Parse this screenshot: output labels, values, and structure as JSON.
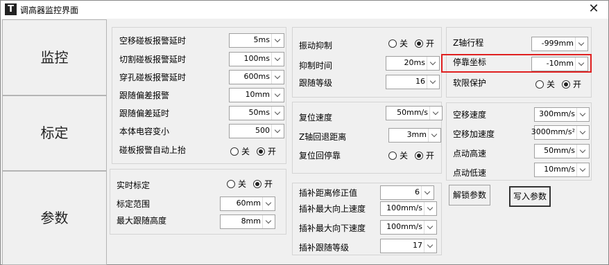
{
  "window": {
    "title": "调高器监控界面",
    "icon_letter": "T",
    "close_glyph": "✕"
  },
  "nav": {
    "monitor": "监控",
    "calibration": "标定",
    "params": "参数"
  },
  "alarms": {
    "items": [
      {
        "label": "空移碰板报警延时",
        "value": "5ms"
      },
      {
        "label": "切割碰板报警延时",
        "value": "100ms"
      },
      {
        "label": "穿孔碰板报警延时",
        "value": "600ms"
      },
      {
        "label": "跟随偏差报警",
        "value": "10mm"
      },
      {
        "label": "跟随偏差延时",
        "value": "50ms"
      },
      {
        "label": "本体电容变小",
        "value": "500"
      }
    ],
    "auto_lift": {
      "label": "碰板报警自动上抬",
      "off": "关",
      "on": "开",
      "selected": "on"
    }
  },
  "realtime_cal": {
    "label": "实时标定",
    "off": "关",
    "on": "开",
    "selected": "on",
    "range_label": "标定范围",
    "range_value": "60mm",
    "max_follow_label": "最大跟随高度",
    "max_follow_value": "8mm"
  },
  "vibration": {
    "label": "振动抑制",
    "off": "关",
    "on": "开",
    "selected": "on",
    "suppress_time_label": "抑制时间",
    "suppress_time_value": "20ms",
    "follow_level_label": "跟随等级",
    "follow_level_value": "16"
  },
  "reset": {
    "speed_label": "复位速度",
    "speed_value": "50mm/s",
    "z_retract_label": "Z轴回退距离",
    "z_retract_value": "3mm",
    "stop_label": "复位回停靠",
    "off": "关",
    "on": "开",
    "selected": "on"
  },
  "interp": {
    "offset_label": "插补距离修正值",
    "offset_value": "6",
    "max_up_label": "插补最大向上速度",
    "max_up_value": "100mm/s",
    "max_down_label": "插补最大向下速度",
    "max_down_value": "100mm/s",
    "follow_level_label": "插补跟随等级",
    "follow_level_value": "17"
  },
  "zaxis": {
    "travel_label": "Z轴行程",
    "travel_value": "-999mm",
    "park_label": "停靠坐标",
    "park_value": "-10mm",
    "soft_limit_label": "软限保护",
    "off": "关",
    "on": "开",
    "selected": "on"
  },
  "motion": {
    "idle_speed_label": "空移速度",
    "idle_speed_value": "300mm/s",
    "idle_accel_label": "空移加速度",
    "idle_accel_value": "3000mm/s²",
    "jog_high_label": "点动高速",
    "jog_high_value": "50mm/s",
    "jog_low_label": "点动低速",
    "jog_low_value": "10mm/s"
  },
  "buttons": {
    "unlock": "解锁参数",
    "write": "写入参数"
  },
  "colors": {
    "highlight": "#e02020"
  }
}
